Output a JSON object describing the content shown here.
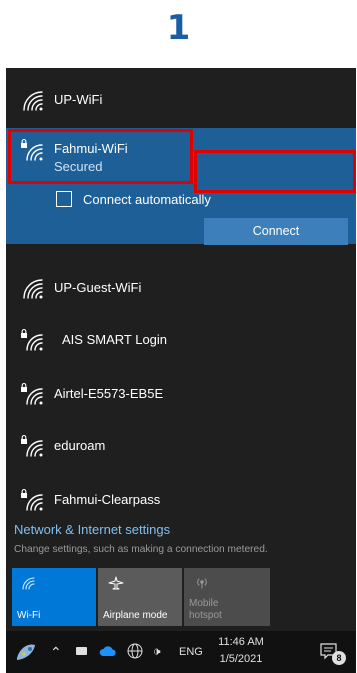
{
  "step_number": "1",
  "networks": {
    "top": {
      "name": "UP-WiFi"
    },
    "selected": {
      "name": "Fahmui-WiFi",
      "status": "Secured",
      "auto_label": "Connect automatically",
      "auto_checked": false,
      "connect_label": "Connect"
    },
    "list": [
      {
        "name": "UP-Guest-WiFi",
        "secured": false
      },
      {
        "name": "AIS SMART Login",
        "secured": true
      },
      {
        "name": "Airtel-E5573-EB5E",
        "secured": true
      },
      {
        "name": "eduroam",
        "secured": true
      },
      {
        "name": "Fahmui-Clearpass",
        "secured": true
      }
    ]
  },
  "settings": {
    "title": "Network & Internet settings",
    "subtitle": "Change settings, such as making a connection metered."
  },
  "quick_actions": [
    {
      "label": "Wi-Fi",
      "icon": "wifi-icon",
      "active": true
    },
    {
      "label": "Airplane mode",
      "icon": "airplane-icon",
      "active": false
    },
    {
      "label": "Mobile hotspot",
      "icon": "hotspot-icon",
      "active": false,
      "disabled": true
    }
  ],
  "taskbar": {
    "language": "ENG",
    "time": "11:46 AM",
    "date": "1/5/2021",
    "notification_count": "8"
  },
  "colors": {
    "panel_bg": "#1f1f1f",
    "selected_bg": "#1d5f96",
    "connect_button": "#3c7fba",
    "highlight_red": "#e00000",
    "link_blue": "#7ec0f0",
    "tile_active": "#0078d7",
    "step_number": "#1a5ea3"
  }
}
